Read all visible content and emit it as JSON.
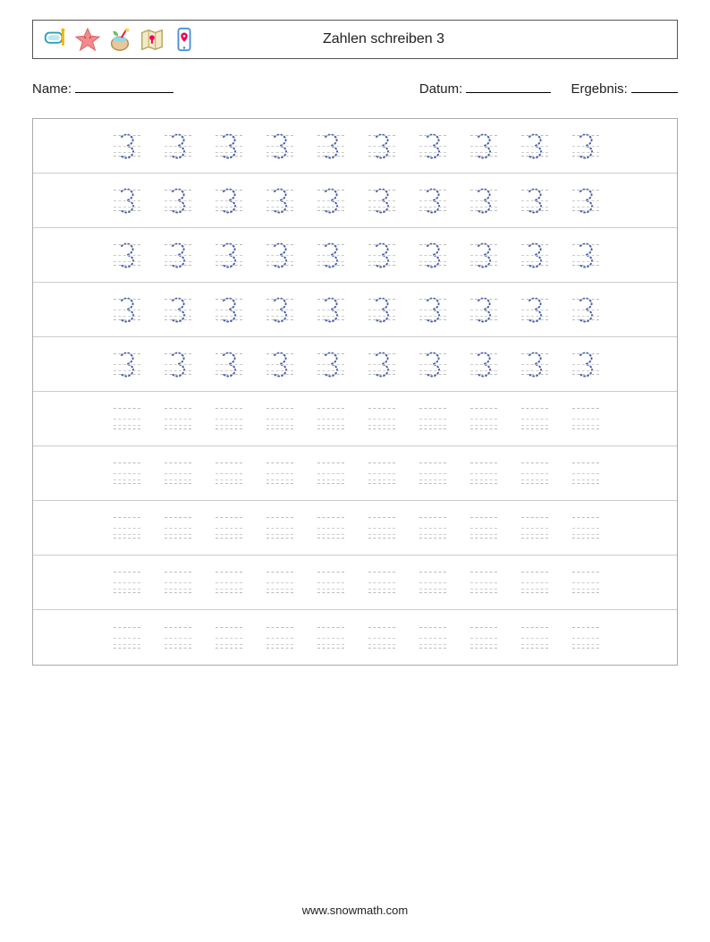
{
  "header": {
    "title": "Zahlen schreiben 3",
    "icons": [
      "snorkel-mask-icon",
      "starfish-icon",
      "coconut-drink-icon",
      "map-icon",
      "phone-location-icon"
    ]
  },
  "meta": {
    "name_label": "Name:",
    "date_label": "Datum:",
    "result_label": "Ergebnis:"
  },
  "worksheet": {
    "traced_glyph": "3",
    "rows_with_trace": 5,
    "rows_blank": 5,
    "cells_per_row": 10
  },
  "footer": {
    "url": "www.snowmath.com"
  }
}
